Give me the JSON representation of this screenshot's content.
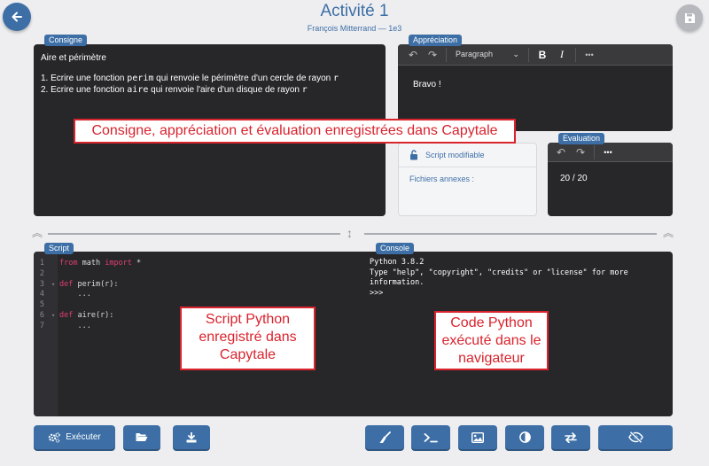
{
  "header": {
    "title": "Activité 1",
    "subtitle": "François Mitterrand — 1e3"
  },
  "consigne": {
    "tag": "Consigne",
    "heading": "Aire et périmètre",
    "item1_pre": "1. Ecrire une fonction ",
    "item1_code": "perim",
    "item1_mid": " qui renvoie le périmètre d'un cercle de rayon ",
    "item1_var": "r",
    "item2_pre": "2. Ecrire une fonction ",
    "item2_code": "aire",
    "item2_mid": " qui renvoie l'aire d'un disque de rayon ",
    "item2_var": "r"
  },
  "appreciation": {
    "tag": "Appréciation",
    "format_select": "Paragraph",
    "bold_label": "B",
    "italic_label": "I",
    "more_label": "•••",
    "text": "Bravo !"
  },
  "meta": {
    "script_status": "Script modifiable",
    "annex_label": "Fichiers annexes :"
  },
  "evaluation": {
    "tag": "Evaluation",
    "more_label": "•••",
    "value": "20 / 20"
  },
  "script": {
    "tag": "Script",
    "lines": [
      {
        "n": "1",
        "a": "from",
        "b": " math ",
        "c": "import",
        "d": " *"
      },
      {
        "n": "2",
        "t": ""
      },
      {
        "n": "3",
        "a": "def",
        "b": " perim(r):"
      },
      {
        "n": "4",
        "t": "    ..."
      },
      {
        "n": "5",
        "t": ""
      },
      {
        "n": "6",
        "a": "def",
        "b": " aire(r):"
      },
      {
        "n": "7",
        "t": "    ..."
      }
    ]
  },
  "console": {
    "tag": "Console",
    "line1": "Python 3.8.2",
    "line2": "Type \"help\", \"copyright\", \"credits\" or \"license\" for more information.",
    "line3": ">>>"
  },
  "callouts": {
    "top": "Consigne, appréciation et évaluation enregistrées dans Capytale",
    "script": "Script Python enregistré dans Capytale",
    "console": "Code Python exécuté dans le navigateur"
  },
  "buttons": {
    "run_label": "Exécuter"
  },
  "colors": {
    "accent": "#3d6fa6",
    "editor_bg": "#27272a",
    "callout": "#d9232d",
    "keyword": "#e03f6c"
  }
}
